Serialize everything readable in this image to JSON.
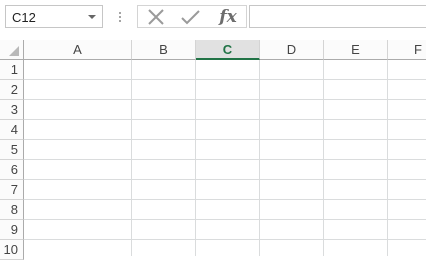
{
  "formula_bar": {
    "name_box_value": "C12",
    "fx_label": "fx",
    "formula_value": ""
  },
  "columns": [
    "A",
    "B",
    "C",
    "D",
    "E",
    "F"
  ],
  "selected_column": "C",
  "rows": [
    "1",
    "2",
    "3",
    "4",
    "5",
    "6",
    "7",
    "8",
    "9",
    "10"
  ],
  "colors": {
    "accent": "#217346",
    "header_bg": "#fbfbfb",
    "selected_header_bg": "#e1e1e1",
    "gridline": "#dadcdd"
  }
}
